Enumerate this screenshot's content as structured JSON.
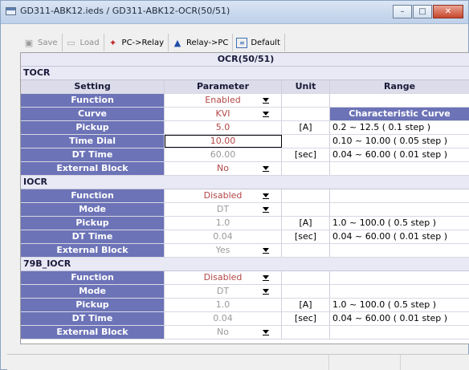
{
  "window": {
    "title": "GD311-ABK12.ieds / GD311-ABK12-OCR(50/51)",
    "controls": {
      "minimize": "–",
      "maximize": "□",
      "close": "✕"
    }
  },
  "toolbar": {
    "save": {
      "label": "Save",
      "icon": "save-icon"
    },
    "load": {
      "label": "Load",
      "icon": "folder-icon"
    },
    "pc_relay": {
      "label": "PC->Relay",
      "icon": "upload-icon"
    },
    "relay_pc": {
      "label": "Relay->PC",
      "icon": "download-icon"
    },
    "default": {
      "label": "Default",
      "icon": "default-icon"
    }
  },
  "panel": {
    "title": "OCR(50/51)",
    "headers": {
      "setting": "Setting",
      "parameter": "Parameter",
      "unit": "Unit",
      "range": "Range"
    },
    "char_curve": "Characteristic Curve",
    "tocr": {
      "title": "TOCR",
      "rows": [
        {
          "setting": "Function",
          "value": "Enabled",
          "unit": "",
          "range": ""
        },
        {
          "setting": "Curve",
          "value": "KVI",
          "unit": "",
          "range": ""
        },
        {
          "setting": "Pickup",
          "value": "5.0",
          "unit": "[A]",
          "range": "0.2 ~ 12.5 ( 0.1 step )"
        },
        {
          "setting": "Time Dial",
          "value": "10.00",
          "unit": "",
          "range": "0.10 ~ 10.00 ( 0.05 step )"
        },
        {
          "setting": "DT Time",
          "value": "60.00",
          "unit": "[sec]",
          "range": "0.04 ~ 60.00 ( 0.01 step )"
        },
        {
          "setting": "External Block",
          "value": "No",
          "unit": "",
          "range": ""
        }
      ]
    },
    "iocr": {
      "title": "IOCR",
      "rows": [
        {
          "setting": "Function",
          "value": "Disabled",
          "unit": "",
          "range": ""
        },
        {
          "setting": "Mode",
          "value": "DT",
          "unit": "",
          "range": ""
        },
        {
          "setting": "Pickup",
          "value": "1.0",
          "unit": "[A]",
          "range": "1.0 ~ 100.0 ( 0.5 step )"
        },
        {
          "setting": "DT Time",
          "value": "0.04",
          "unit": "[sec]",
          "range": "0.04 ~ 60.00 ( 0.01 step )"
        },
        {
          "setting": "External Block",
          "value": "Yes",
          "unit": "",
          "range": ""
        }
      ]
    },
    "b79_iocr": {
      "title": "79B_IOCR",
      "rows": [
        {
          "setting": "Function",
          "value": "Disabled",
          "unit": "",
          "range": ""
        },
        {
          "setting": "Mode",
          "value": "DT",
          "unit": "",
          "range": ""
        },
        {
          "setting": "Pickup",
          "value": "1.0",
          "unit": "[A]",
          "range": "1.0 ~ 100.0 ( 0.5 step )"
        },
        {
          "setting": "DT Time",
          "value": "0.04",
          "unit": "[sec]",
          "range": "0.04 ~ 60.00 ( 0.01 step )"
        },
        {
          "setting": "External Block",
          "value": "No",
          "unit": "",
          "range": ""
        }
      ]
    }
  },
  "colors": {
    "label_bg": "#6c73b7",
    "value_red": "#b34646",
    "value_gray": "#9a9a9a"
  }
}
